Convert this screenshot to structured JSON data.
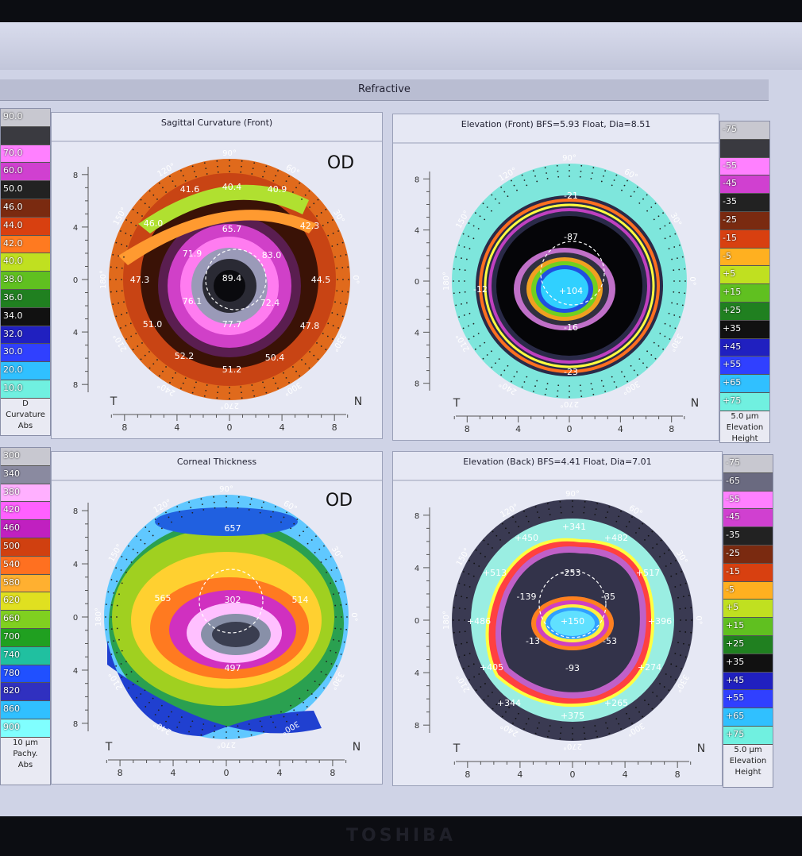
{
  "window": {
    "title": "Refractive",
    "brand": "TOSHIBA"
  },
  "panels": {
    "sagittal": {
      "title": "Sagittal Curvature (Front)",
      "eye": "OD",
      "angles": [
        "90°",
        "60°",
        "30°",
        "0°",
        "330°",
        "300°",
        "270°",
        "240°",
        "210°",
        "180°",
        "150°",
        "120°"
      ],
      "nasal": "N",
      "temporal": "T",
      "ticks_x": [
        "8",
        "4",
        "0",
        "4",
        "8"
      ],
      "ticks_y": [
        "8",
        "4",
        "0",
        "4",
        "8"
      ],
      "values": [
        {
          "v": "40.4"
        },
        {
          "v": "41.6"
        },
        {
          "v": "40.9"
        },
        {
          "v": "46.0"
        },
        {
          "v": "42.3"
        },
        {
          "v": "65.7"
        },
        {
          "v": "71.9"
        },
        {
          "v": "83.0"
        },
        {
          "v": "47.3"
        },
        {
          "v": "89.4"
        },
        {
          "v": "44.5"
        },
        {
          "v": "76.1"
        },
        {
          "v": "72.4"
        },
        {
          "v": "51.0"
        },
        {
          "v": "77.7"
        },
        {
          "v": "47.8"
        },
        {
          "v": "52.2"
        },
        {
          "v": "50.4"
        },
        {
          "v": "51.2"
        }
      ],
      "scale": {
        "items": [
          {
            "label": "90.0",
            "color": "#c8c8d0"
          },
          {
            "label": "",
            "color": "#3a3a40"
          },
          {
            "label": "70.0",
            "color": "#ff80ff"
          },
          {
            "label": "60.0",
            "color": "#d040d0"
          },
          {
            "label": "50.0",
            "color": "#222"
          },
          {
            "label": "46.0",
            "color": "#7a2a10"
          },
          {
            "label": "44.0",
            "color": "#d84010"
          },
          {
            "label": "42.0",
            "color": "#ff7a20"
          },
          {
            "label": "40.0",
            "color": "#c0e020"
          },
          {
            "label": "38.0",
            "color": "#60c020"
          },
          {
            "label": "36.0",
            "color": "#208020"
          },
          {
            "label": "34.0",
            "color": "#111"
          },
          {
            "label": "32.0",
            "color": "#2020c0"
          },
          {
            "label": "30.0",
            "color": "#3040ff"
          },
          {
            "label": "20.0",
            "color": "#30c0ff"
          },
          {
            "label": "10.0",
            "color": "#70f0e0"
          }
        ],
        "footer": [
          "D",
          "Curvature",
          "Abs"
        ]
      }
    },
    "elev_front": {
      "title": "Elevation (Front)  BFS=5.93 Float, Dia=8.51",
      "angles": [
        "90°",
        "60°",
        "30°",
        "0°",
        "330°",
        "300°",
        "270°",
        "240°",
        "210°",
        "180°",
        "150°",
        "120°"
      ],
      "nasal": "N",
      "temporal": "T",
      "ticks_x": [
        "8",
        "4",
        "0",
        "4",
        "8"
      ],
      "ticks_y": [
        "8",
        "4",
        "0",
        "4",
        "8"
      ],
      "values": [
        {
          "v": "-87"
        },
        {
          "v": "+104"
        },
        {
          "v": "-12"
        },
        {
          "v": "-16"
        },
        {
          "v": "-23"
        },
        {
          "v": "-21"
        }
      ],
      "scale": {
        "items": [
          {
            "label": "-75",
            "color": "#c8c8d0"
          },
          {
            "label": "",
            "color": "#3a3a40"
          },
          {
            "label": "-55",
            "color": "#ff80ff"
          },
          {
            "label": "-45",
            "color": "#d040d0"
          },
          {
            "label": "-35",
            "color": "#222"
          },
          {
            "label": "-25",
            "color": "#7a2a10"
          },
          {
            "label": "-15",
            "color": "#d84010"
          },
          {
            "label": "-5",
            "color": "#ffb020"
          },
          {
            "label": "+5",
            "color": "#c0e020"
          },
          {
            "label": "+15",
            "color": "#60c020"
          },
          {
            "label": "+25",
            "color": "#208020"
          },
          {
            "label": "+35",
            "color": "#111"
          },
          {
            "label": "+45",
            "color": "#2020c0"
          },
          {
            "label": "+55",
            "color": "#3040ff"
          },
          {
            "label": "+65",
            "color": "#30c0ff"
          },
          {
            "label": "+75",
            "color": "#70f0e0"
          }
        ],
        "footer": [
          "5.0 µm",
          "Elevation",
          "Height"
        ]
      }
    },
    "thickness": {
      "title": "Corneal Thickness",
      "eye": "OD",
      "angles": [
        "90°",
        "60°",
        "30°",
        "0°",
        "330°",
        "300°",
        "270°",
        "240°",
        "210°",
        "180°",
        "150°",
        "120°"
      ],
      "nasal": "N",
      "temporal": "T",
      "ticks_x": [
        "8",
        "4",
        "0",
        "4",
        "8"
      ],
      "ticks_y": [
        "8",
        "4",
        "0",
        "4",
        "8"
      ],
      "values": [
        {
          "v": "657"
        },
        {
          "v": "565"
        },
        {
          "v": "302"
        },
        {
          "v": "514"
        },
        {
          "v": "497"
        }
      ],
      "scale": {
        "items": [
          {
            "label": "300",
            "color": "#c8c8d0"
          },
          {
            "label": "340",
            "color": "#8a8aa0"
          },
          {
            "label": "380",
            "color": "#ffb0ff"
          },
          {
            "label": "420",
            "color": "#ff60ff"
          },
          {
            "label": "460",
            "color": "#c020c0"
          },
          {
            "label": "500",
            "color": "#d04010"
          },
          {
            "label": "540",
            "color": "#ff7020"
          },
          {
            "label": "580",
            "color": "#ffb030"
          },
          {
            "label": "620",
            "color": "#e0e020"
          },
          {
            "label": "660",
            "color": "#80d020"
          },
          {
            "label": "700",
            "color": "#20a020"
          },
          {
            "label": "740",
            "color": "#20c0a0"
          },
          {
            "label": "780",
            "color": "#2050ff"
          },
          {
            "label": "820",
            "color": "#3030c0"
          },
          {
            "label": "860",
            "color": "#30c0ff"
          },
          {
            "label": "900",
            "color": "#80ffff"
          }
        ],
        "footer": [
          "10 µm",
          "Pachy.",
          "Abs"
        ]
      }
    },
    "elev_back": {
      "title": "Elevation (Back)  BFS=4.41 Float, Dia=7.01",
      "angles": [
        "90°",
        "60°",
        "30°",
        "0°",
        "330°",
        "300°",
        "270°",
        "240°",
        "210°",
        "180°",
        "150°",
        "120°"
      ],
      "nasal": "N",
      "temporal": "T",
      "ticks_x": [
        "8",
        "4",
        "0",
        "4",
        "8"
      ],
      "ticks_y": [
        "8",
        "4",
        "0",
        "4",
        "8"
      ],
      "values": [
        {
          "v": "+341"
        },
        {
          "v": "+450"
        },
        {
          "v": "+482"
        },
        {
          "v": "+513"
        },
        {
          "v": "-253"
        },
        {
          "v": "+517"
        },
        {
          "v": "-139"
        },
        {
          "v": "-35"
        },
        {
          "v": "+486"
        },
        {
          "v": "+150"
        },
        {
          "v": "+396"
        },
        {
          "v": "-13"
        },
        {
          "v": "-53"
        },
        {
          "v": "+405"
        },
        {
          "v": "-93"
        },
        {
          "v": "+274"
        },
        {
          "v": "+344"
        },
        {
          "v": "+265"
        },
        {
          "v": "+375"
        }
      ],
      "scale": {
        "items": [
          {
            "label": "-75",
            "color": "#c8c8d0"
          },
          {
            "label": "-65",
            "color": "#6a6a80"
          },
          {
            "label": "-55",
            "color": "#ff80ff"
          },
          {
            "label": "-45",
            "color": "#d040d0"
          },
          {
            "label": "-35",
            "color": "#222"
          },
          {
            "label": "-25",
            "color": "#7a2a10"
          },
          {
            "label": "-15",
            "color": "#d84010"
          },
          {
            "label": "-5",
            "color": "#ffb020"
          },
          {
            "label": "+5",
            "color": "#c0e020"
          },
          {
            "label": "+15",
            "color": "#60c020"
          },
          {
            "label": "+25",
            "color": "#208020"
          },
          {
            "label": "+35",
            "color": "#111"
          },
          {
            "label": "+45",
            "color": "#2020c0"
          },
          {
            "label": "+55",
            "color": "#3040ff"
          },
          {
            "label": "+65",
            "color": "#30c0ff"
          },
          {
            "label": "+75",
            "color": "#70f0e0"
          }
        ],
        "footer": [
          "5.0 µm",
          "Elevation",
          "Height"
        ]
      }
    }
  }
}
